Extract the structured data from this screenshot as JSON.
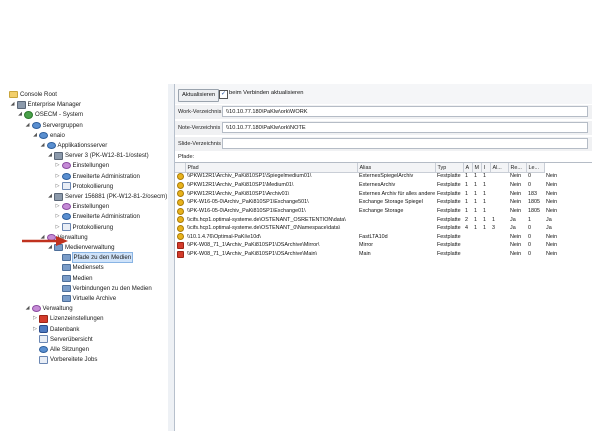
{
  "tree": {
    "nodes": [
      {
        "label": "Console Root",
        "icon": "folder-icon",
        "level": 0,
        "expand": ""
      },
      {
        "label": "Enterprise Manager",
        "icon": "server-icon",
        "level": 1,
        "expand": "◢"
      },
      {
        "label": "OSECM - System",
        "icon": "globe-icon",
        "level": 2,
        "expand": "◢"
      },
      {
        "label": "Servergruppen",
        "icon": "users-icon",
        "level": 3,
        "expand": "◢"
      },
      {
        "label": "enaio",
        "icon": "users-icon",
        "level": 4,
        "expand": "◢"
      },
      {
        "label": "Applikationsserver",
        "icon": "users-icon",
        "level": 5,
        "expand": "◢"
      },
      {
        "label": "Server 3 (PK-W12-81-1/ostest)",
        "icon": "server-icon",
        "level": 6,
        "expand": "◢"
      },
      {
        "label": "Einstellungen",
        "icon": "gear-icon",
        "level": 7,
        "expand": "▷"
      },
      {
        "label": "Erweiterte Administration",
        "icon": "users-icon",
        "level": 7,
        "expand": "▷"
      },
      {
        "label": "Protokollierung",
        "icon": "doc-icon",
        "level": 7,
        "expand": "▷"
      },
      {
        "label": "Server 156881 (PK-W12-81-2/osecm)",
        "icon": "server-icon",
        "level": 6,
        "expand": "◢"
      },
      {
        "label": "Einstellungen",
        "icon": "gear-icon",
        "level": 7,
        "expand": "▷"
      },
      {
        "label": "Erweiterte Administration",
        "icon": "users-icon",
        "level": 7,
        "expand": "▷"
      },
      {
        "label": "Protokollierung",
        "icon": "doc-icon",
        "level": 7,
        "expand": "▷"
      },
      {
        "label": "Verwaltung",
        "icon": "gear-icon",
        "level": 5,
        "expand": "◢"
      },
      {
        "label": "Medienverwaltung",
        "icon": "media-icon",
        "level": 6,
        "expand": "◢"
      },
      {
        "label": "Pfade zu den Medien",
        "icon": "media-icon",
        "level": 7,
        "expand": "",
        "selected": true
      },
      {
        "label": "Mediensets",
        "icon": "media-icon",
        "level": 7,
        "expand": ""
      },
      {
        "label": "Medien",
        "icon": "media-icon",
        "level": 7,
        "expand": ""
      },
      {
        "label": "Verbindungen zu den Medien",
        "icon": "media-icon",
        "level": 7,
        "expand": ""
      },
      {
        "label": "Virtuelle Archive",
        "icon": "media-icon",
        "level": 7,
        "expand": ""
      },
      {
        "label": "Verwaltung",
        "icon": "gear-icon",
        "level": 3,
        "expand": "◢"
      },
      {
        "label": "Lizenzeinstellungen",
        "icon": "red-icon",
        "level": 4,
        "expand": "▷"
      },
      {
        "label": "Datenbank",
        "icon": "db-icon",
        "level": 4,
        "expand": "▷"
      },
      {
        "label": "Serverübersicht",
        "icon": "doc-icon",
        "level": 4,
        "expand": ""
      },
      {
        "label": "Alle Sitzungen",
        "icon": "users-icon",
        "level": 4,
        "expand": ""
      },
      {
        "label": "Vorbereitete Jobs",
        "icon": "doc-icon",
        "level": 4,
        "expand": ""
      }
    ]
  },
  "toolbar": {
    "refresh_label": "Aktualisieren",
    "refresh_on_connect_label": "beim Verbinden aktualisieren",
    "refresh_on_connect_checked": "✓"
  },
  "fields": {
    "work_label": "Work-Verzeichnis",
    "work_value": "\\\\10.10.77.180\\PaKlw\\ork\\WORK",
    "note_label": "Note-Verzeichnis",
    "note_value": "\\\\10.10.77.180\\PaKlw\\ork\\NOTE",
    "slide_label": "Slide-Verzeichnis",
    "slide_value": "",
    "paths_label": "Pfade:"
  },
  "table": {
    "columns": [
      "",
      "Pfad",
      "Alias",
      "Typ",
      "A",
      "M",
      "I",
      "Al...",
      "Re...",
      "Le..."
    ],
    "rows": [
      {
        "icon": "yellow",
        "cells": [
          "\\\\PKW12R1\\Archiv_PaKi810SP1\\Spiegelmedium01\\",
          "ExternesSpiegelArchiv",
          "Festplatte",
          "1",
          "1",
          "1",
          "",
          "Nein",
          "0",
          "Nein"
        ]
      },
      {
        "icon": "yellow",
        "cells": [
          "\\\\PKW12R1\\Archiv_PaKi810SP1\\Medium01\\",
          "ExternesArchiv",
          "Festplatte",
          "1",
          "1",
          "1",
          "",
          "Nein",
          "0",
          "Nein"
        ]
      },
      {
        "icon": "yellow",
        "cells": [
          "\\\\PKW12R1\\Archiv_PaKi810SP1\\Archiv01\\",
          "Externes Archiv für alles andere",
          "Festplatte",
          "1",
          "1",
          "1",
          "",
          "Nein",
          "183",
          "Nein"
        ]
      },
      {
        "icon": "yellow",
        "cells": [
          "\\\\PK-W16-05-0\\Archiv_PaKi810SP1\\Exchange501\\",
          "Exchange Storage Spiegel",
          "Festplatte",
          "1",
          "1",
          "1",
          "",
          "Nein",
          "1805",
          "Nein"
        ]
      },
      {
        "icon": "yellow",
        "cells": [
          "\\\\PK-W16-05-0\\Archiv_PaKi810SP1\\Exchange01\\",
          "Exchange Storage",
          "Festplatte",
          "1",
          "1",
          "1",
          "",
          "Nein",
          "1805",
          "Nein"
        ]
      },
      {
        "icon": "yellow",
        "cells": [
          "\\\\cifs.hcp1.optimal-systeme.de\\OSTENANT_OSRETENTION\\data\\",
          "",
          "Festplatte",
          "2",
          "1",
          "1",
          "1",
          "Ja",
          "1",
          "Ja"
        ]
      },
      {
        "icon": "yellow",
        "cells": [
          "\\\\cifs.hcp1.optimal-systeme.de\\OSTENANT_0\\Namespace\\data\\",
          "",
          "Festplatte",
          "4",
          "1",
          "1",
          "3",
          "Ja",
          "0",
          "Ja"
        ]
      },
      {
        "icon": "yellow",
        "cells": [
          "\\\\10.1.4.76\\Optimal-PaKi\\e10d\\",
          "FastLTA10d",
          "Festplatte",
          "",
          "",
          "",
          "",
          "Nein",
          "0",
          "Nein"
        ]
      },
      {
        "icon": "red",
        "cells": [
          "\\\\PK-W08_71_1\\Archiv_PaKi810SP1\\OSArchive\\Mirror\\",
          "Mirror",
          "Festplatte",
          "",
          "",
          "",
          "",
          "Nein",
          "0",
          "Nein"
        ]
      },
      {
        "icon": "red",
        "cells": [
          "\\\\PK-W08_71_1\\Archiv_PaKi810SP1\\OSArchive\\Main\\",
          "Main",
          "Festplatte",
          "",
          "",
          "",
          "",
          "Nein",
          "0",
          "Nein"
        ]
      }
    ]
  },
  "colors": {
    "accent_selection": "#cfe3fa",
    "arrow": "#c0321f",
    "media_icon": "#e8b21c"
  }
}
